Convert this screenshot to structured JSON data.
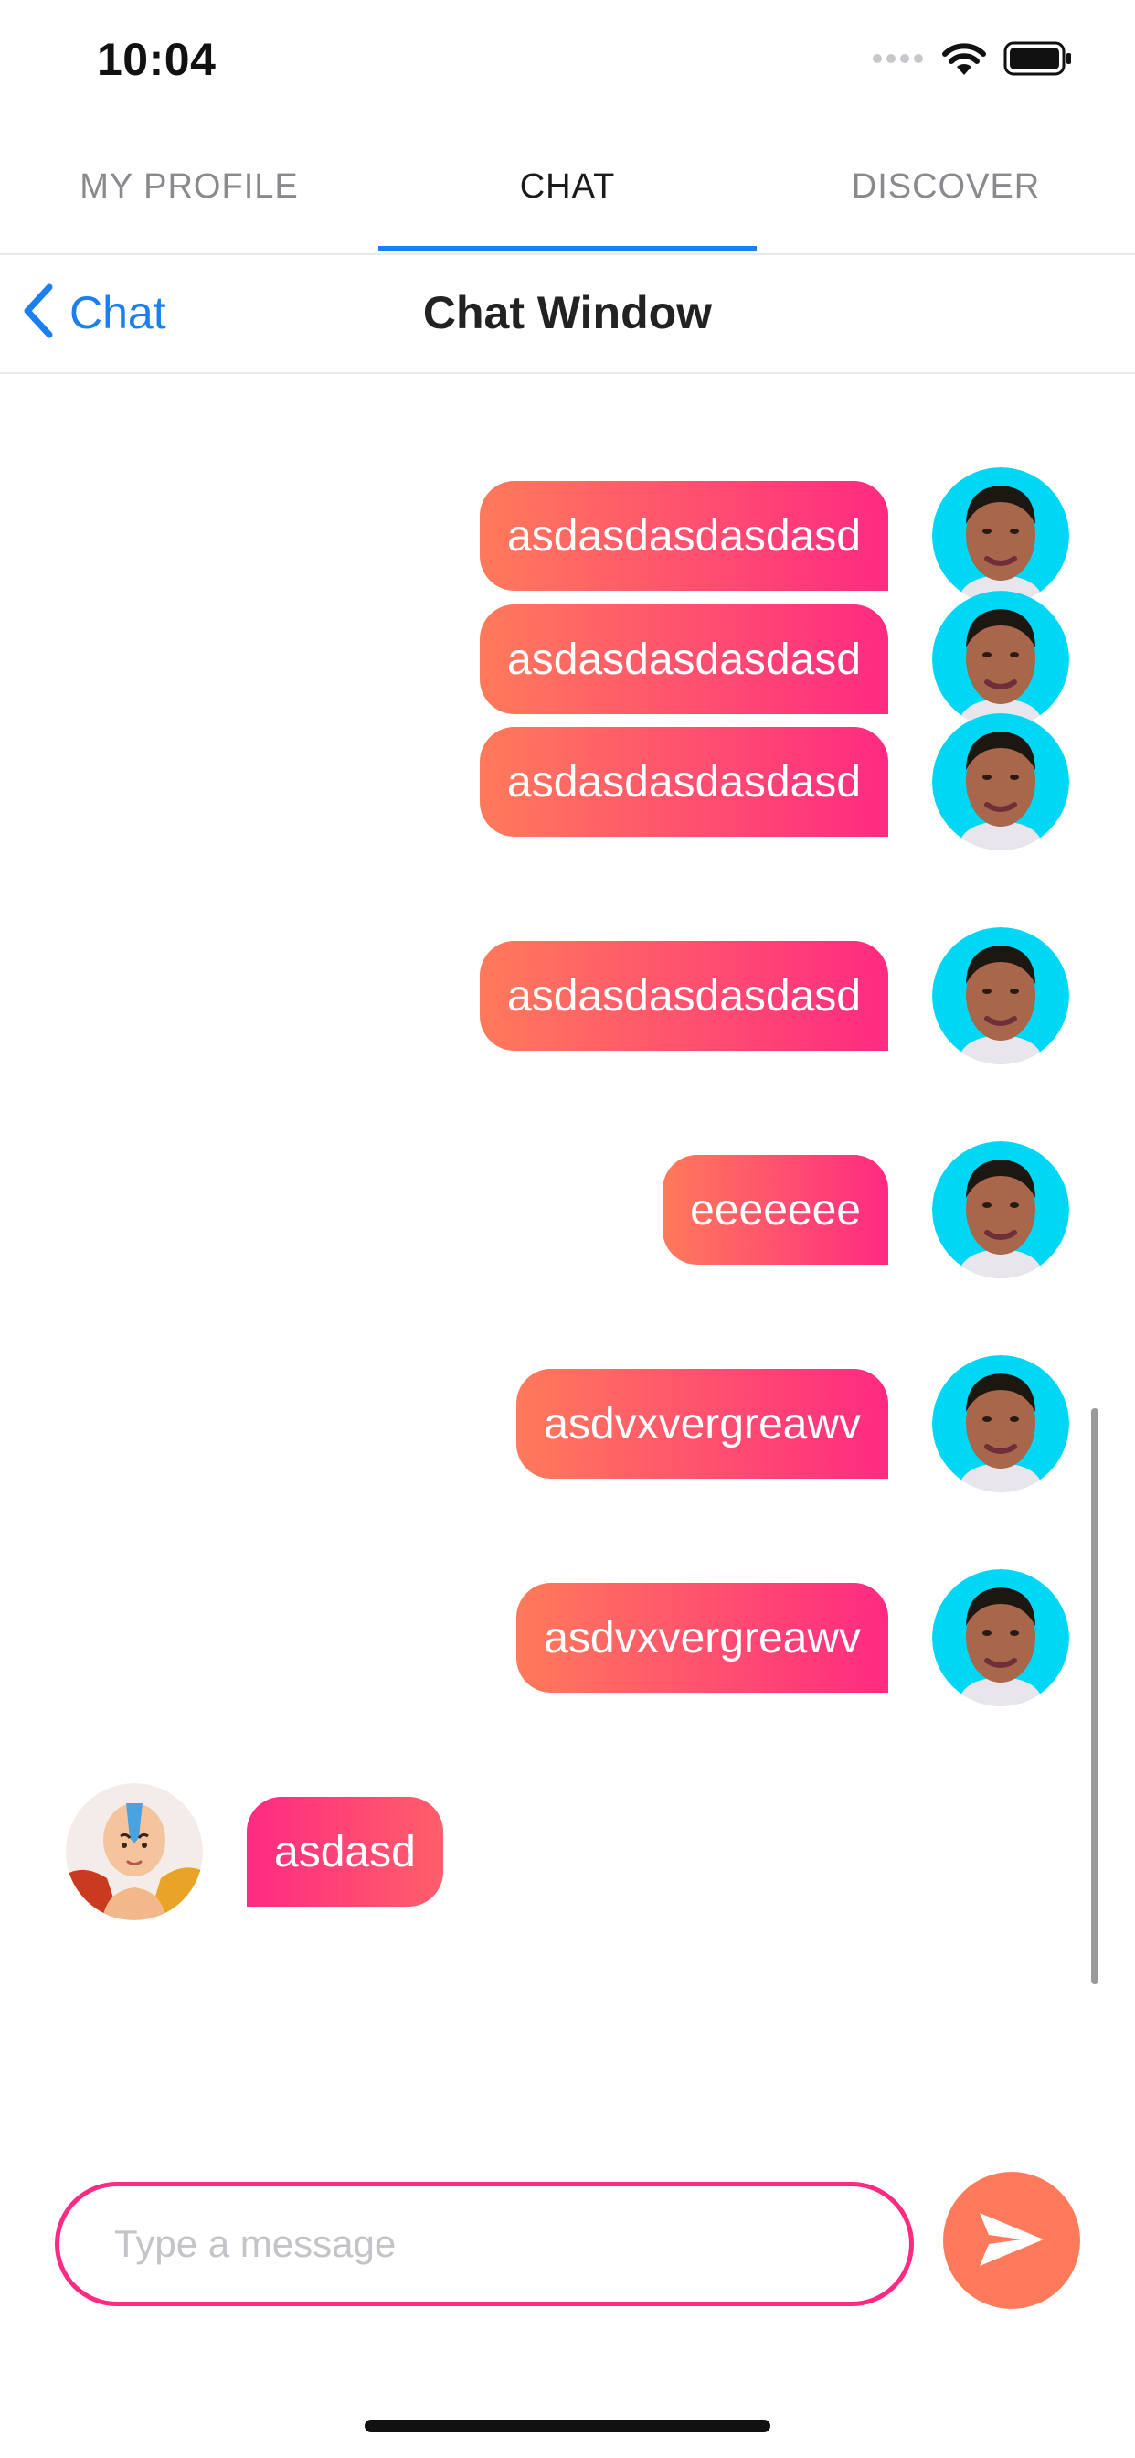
{
  "status_bar": {
    "time": "10:04",
    "icons": [
      "cellular-signal-icon",
      "wifi-icon",
      "battery-icon"
    ]
  },
  "tabs": [
    {
      "label": "MY PROFILE",
      "active": false
    },
    {
      "label": "CHAT",
      "active": true
    },
    {
      "label": "DISCOVER",
      "active": false
    }
  ],
  "nav": {
    "back_label": "Chat",
    "title": "Chat Window"
  },
  "messages": [
    {
      "text": "asdasdasdasdasd",
      "sender": "me"
    },
    {
      "text": "asdasdasdasdasd",
      "sender": "me"
    },
    {
      "text": "asdasdasdasdasd",
      "sender": "me"
    },
    {
      "text": "asdasdasdasdasd",
      "sender": "me"
    },
    {
      "text": "eeeeeee",
      "sender": "me"
    },
    {
      "text": "asdvxvergreawv",
      "sender": "me"
    },
    {
      "text": "asdvxvergreawv",
      "sender": "me"
    },
    {
      "text": "asdasd",
      "sender": "them"
    }
  ],
  "composer": {
    "placeholder": "Type a message",
    "value": "",
    "send_icon": "send-icon"
  },
  "colors": {
    "accent_blue": "#1c7ff0",
    "bubble_gradient_start": "#ff7a5a",
    "bubble_gradient_end": "#ff2a82",
    "send_button": "#ff7a5a",
    "my_avatar_background": "#00d7f4"
  }
}
